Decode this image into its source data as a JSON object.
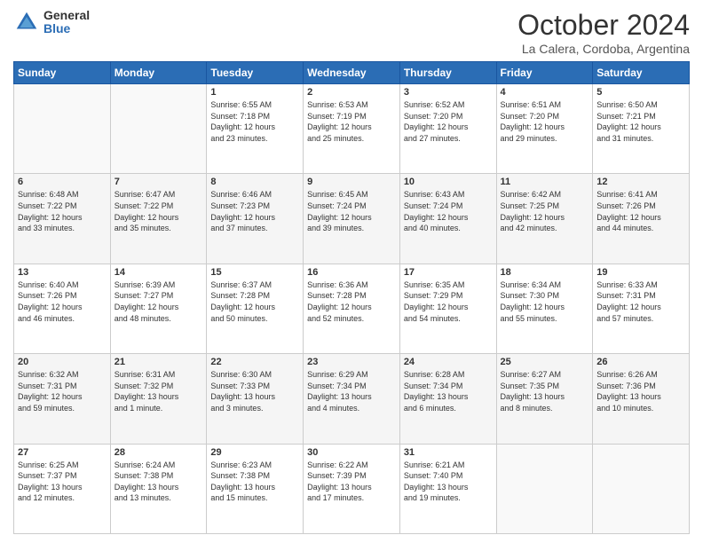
{
  "logo": {
    "general": "General",
    "blue": "Blue"
  },
  "header": {
    "month": "October 2024",
    "location": "La Calera, Cordoba, Argentina"
  },
  "weekdays": [
    "Sunday",
    "Monday",
    "Tuesday",
    "Wednesday",
    "Thursday",
    "Friday",
    "Saturday"
  ],
  "weeks": [
    [
      {
        "day": "",
        "info": ""
      },
      {
        "day": "",
        "info": ""
      },
      {
        "day": "1",
        "info": "Sunrise: 6:55 AM\nSunset: 7:18 PM\nDaylight: 12 hours\nand 23 minutes."
      },
      {
        "day": "2",
        "info": "Sunrise: 6:53 AM\nSunset: 7:19 PM\nDaylight: 12 hours\nand 25 minutes."
      },
      {
        "day": "3",
        "info": "Sunrise: 6:52 AM\nSunset: 7:20 PM\nDaylight: 12 hours\nand 27 minutes."
      },
      {
        "day": "4",
        "info": "Sunrise: 6:51 AM\nSunset: 7:20 PM\nDaylight: 12 hours\nand 29 minutes."
      },
      {
        "day": "5",
        "info": "Sunrise: 6:50 AM\nSunset: 7:21 PM\nDaylight: 12 hours\nand 31 minutes."
      }
    ],
    [
      {
        "day": "6",
        "info": "Sunrise: 6:48 AM\nSunset: 7:22 PM\nDaylight: 12 hours\nand 33 minutes."
      },
      {
        "day": "7",
        "info": "Sunrise: 6:47 AM\nSunset: 7:22 PM\nDaylight: 12 hours\nand 35 minutes."
      },
      {
        "day": "8",
        "info": "Sunrise: 6:46 AM\nSunset: 7:23 PM\nDaylight: 12 hours\nand 37 minutes."
      },
      {
        "day": "9",
        "info": "Sunrise: 6:45 AM\nSunset: 7:24 PM\nDaylight: 12 hours\nand 39 minutes."
      },
      {
        "day": "10",
        "info": "Sunrise: 6:43 AM\nSunset: 7:24 PM\nDaylight: 12 hours\nand 40 minutes."
      },
      {
        "day": "11",
        "info": "Sunrise: 6:42 AM\nSunset: 7:25 PM\nDaylight: 12 hours\nand 42 minutes."
      },
      {
        "day": "12",
        "info": "Sunrise: 6:41 AM\nSunset: 7:26 PM\nDaylight: 12 hours\nand 44 minutes."
      }
    ],
    [
      {
        "day": "13",
        "info": "Sunrise: 6:40 AM\nSunset: 7:26 PM\nDaylight: 12 hours\nand 46 minutes."
      },
      {
        "day": "14",
        "info": "Sunrise: 6:39 AM\nSunset: 7:27 PM\nDaylight: 12 hours\nand 48 minutes."
      },
      {
        "day": "15",
        "info": "Sunrise: 6:37 AM\nSunset: 7:28 PM\nDaylight: 12 hours\nand 50 minutes."
      },
      {
        "day": "16",
        "info": "Sunrise: 6:36 AM\nSunset: 7:28 PM\nDaylight: 12 hours\nand 52 minutes."
      },
      {
        "day": "17",
        "info": "Sunrise: 6:35 AM\nSunset: 7:29 PM\nDaylight: 12 hours\nand 54 minutes."
      },
      {
        "day": "18",
        "info": "Sunrise: 6:34 AM\nSunset: 7:30 PM\nDaylight: 12 hours\nand 55 minutes."
      },
      {
        "day": "19",
        "info": "Sunrise: 6:33 AM\nSunset: 7:31 PM\nDaylight: 12 hours\nand 57 minutes."
      }
    ],
    [
      {
        "day": "20",
        "info": "Sunrise: 6:32 AM\nSunset: 7:31 PM\nDaylight: 12 hours\nand 59 minutes."
      },
      {
        "day": "21",
        "info": "Sunrise: 6:31 AM\nSunset: 7:32 PM\nDaylight: 13 hours\nand 1 minute."
      },
      {
        "day": "22",
        "info": "Sunrise: 6:30 AM\nSunset: 7:33 PM\nDaylight: 13 hours\nand 3 minutes."
      },
      {
        "day": "23",
        "info": "Sunrise: 6:29 AM\nSunset: 7:34 PM\nDaylight: 13 hours\nand 4 minutes."
      },
      {
        "day": "24",
        "info": "Sunrise: 6:28 AM\nSunset: 7:34 PM\nDaylight: 13 hours\nand 6 minutes."
      },
      {
        "day": "25",
        "info": "Sunrise: 6:27 AM\nSunset: 7:35 PM\nDaylight: 13 hours\nand 8 minutes."
      },
      {
        "day": "26",
        "info": "Sunrise: 6:26 AM\nSunset: 7:36 PM\nDaylight: 13 hours\nand 10 minutes."
      }
    ],
    [
      {
        "day": "27",
        "info": "Sunrise: 6:25 AM\nSunset: 7:37 PM\nDaylight: 13 hours\nand 12 minutes."
      },
      {
        "day": "28",
        "info": "Sunrise: 6:24 AM\nSunset: 7:38 PM\nDaylight: 13 hours\nand 13 minutes."
      },
      {
        "day": "29",
        "info": "Sunrise: 6:23 AM\nSunset: 7:38 PM\nDaylight: 13 hours\nand 15 minutes."
      },
      {
        "day": "30",
        "info": "Sunrise: 6:22 AM\nSunset: 7:39 PM\nDaylight: 13 hours\nand 17 minutes."
      },
      {
        "day": "31",
        "info": "Sunrise: 6:21 AM\nSunset: 7:40 PM\nDaylight: 13 hours\nand 19 minutes."
      },
      {
        "day": "",
        "info": ""
      },
      {
        "day": "",
        "info": ""
      }
    ]
  ]
}
